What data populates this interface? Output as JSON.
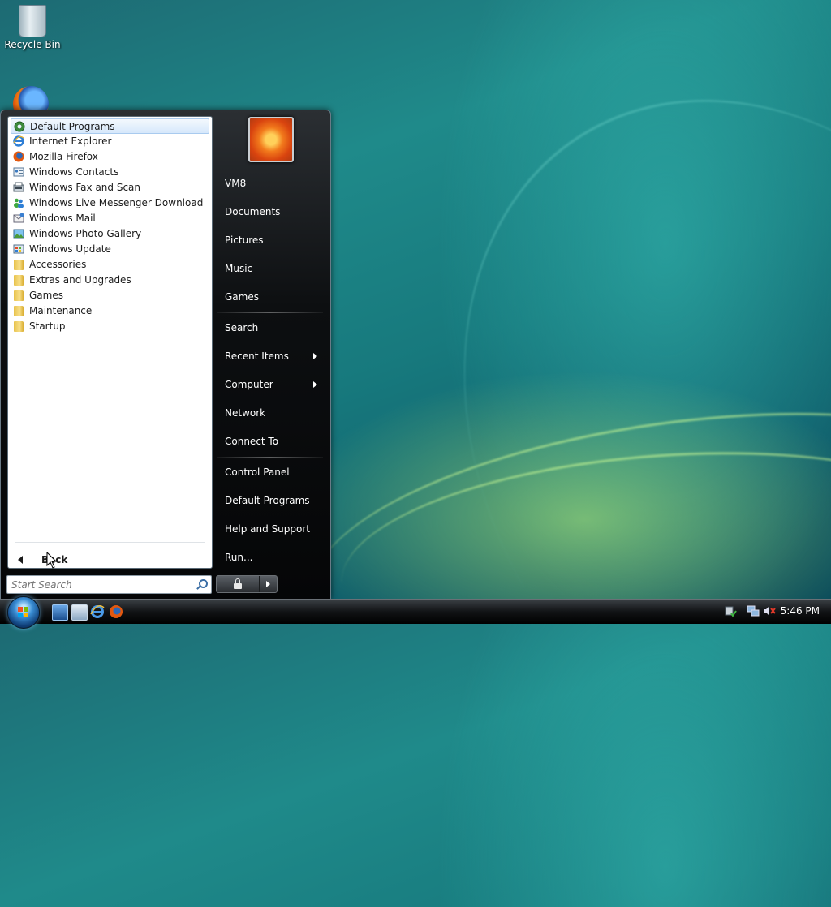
{
  "desktop": {
    "icons": [
      {
        "label": "Recycle Bin"
      },
      {
        "label": ""
      }
    ]
  },
  "start_menu": {
    "programs": [
      {
        "label": "Default Programs",
        "icon": "default-programs-icon",
        "selected": true
      },
      {
        "label": "Internet Explorer",
        "icon": "internet-explorer-icon"
      },
      {
        "label": "Mozilla Firefox",
        "icon": "firefox-icon"
      },
      {
        "label": "Windows Contacts",
        "icon": "contacts-icon"
      },
      {
        "label": "Windows Fax and Scan",
        "icon": "fax-icon"
      },
      {
        "label": "Windows Live Messenger Download",
        "icon": "messenger-icon"
      },
      {
        "label": "Windows Mail",
        "icon": "mail-icon"
      },
      {
        "label": "Windows Photo Gallery",
        "icon": "photo-gallery-icon"
      },
      {
        "label": "Windows Update",
        "icon": "windows-update-icon"
      },
      {
        "label": "Accessories",
        "icon": "folder-icon"
      },
      {
        "label": "Extras and Upgrades",
        "icon": "folder-icon"
      },
      {
        "label": "Games",
        "icon": "folder-icon"
      },
      {
        "label": "Maintenance",
        "icon": "folder-icon"
      },
      {
        "label": "Startup",
        "icon": "folder-icon"
      }
    ],
    "back_label": "Back",
    "search": {
      "placeholder": "Start Search"
    },
    "places": [
      {
        "label": "VM8"
      },
      {
        "label": "Documents"
      },
      {
        "label": "Pictures"
      },
      {
        "label": "Music"
      },
      {
        "label": "Games"
      },
      {
        "label": "Search"
      },
      {
        "label": "Recent Items",
        "submenu": true
      },
      {
        "label": "Computer",
        "submenu": true
      },
      {
        "label": "Network"
      },
      {
        "label": "Connect To"
      },
      {
        "label": "Control Panel"
      },
      {
        "label": "Default Programs"
      },
      {
        "label": "Help and Support"
      },
      {
        "label": "Run..."
      }
    ]
  },
  "taskbar": {
    "clock": "5:46 PM"
  }
}
